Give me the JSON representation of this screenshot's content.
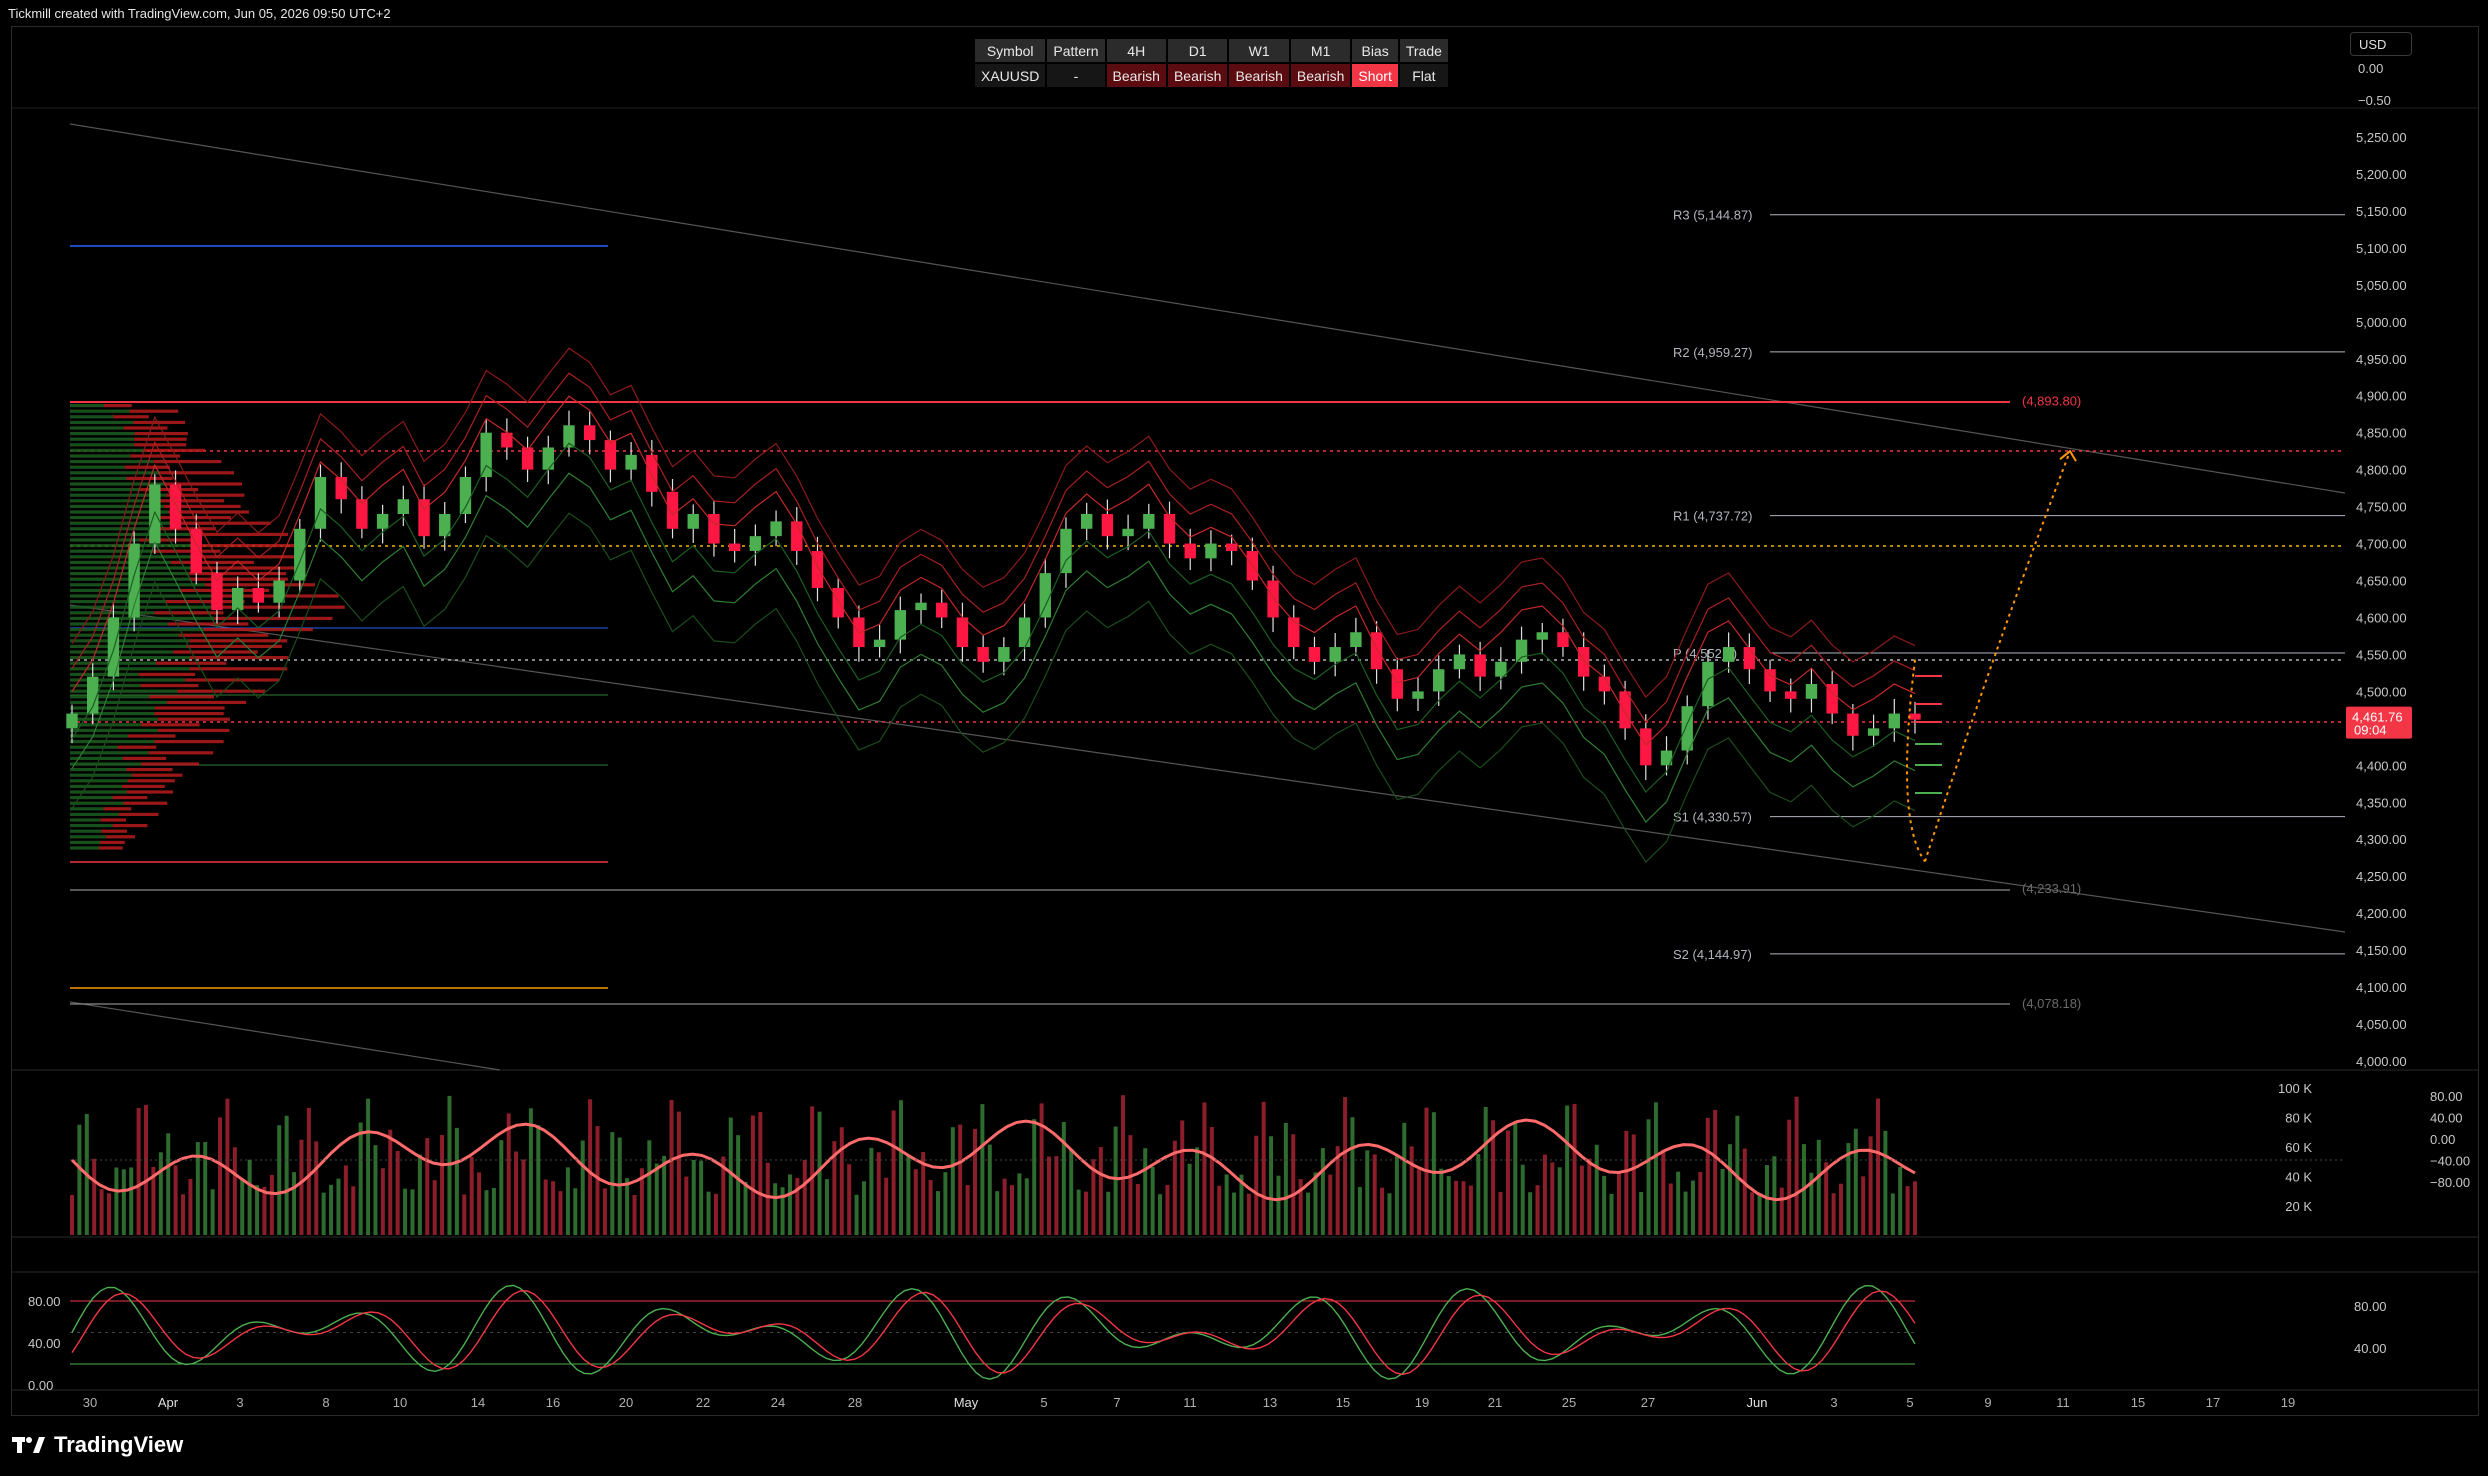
{
  "header": {
    "credit": "Tickmill created with TradingView.com, Jun 05, 2026 09:50 UTC+2"
  },
  "footer": {
    "brand": "TradingView"
  },
  "currency": "USD",
  "bias_table": {
    "headers": [
      "Symbol",
      "Pattern",
      "4H",
      "D1",
      "W1",
      "M1",
      "Bias",
      "Trade"
    ],
    "values": [
      "XAUUSD",
      "-",
      "Bearish",
      "Bearish",
      "Bearish",
      "Bearish",
      "Short",
      "Flat"
    ]
  },
  "colors": {
    "bull": "#2e7d32",
    "bear": "#f23645",
    "pivot": "#b2b5be",
    "dotted": "#f2b600",
    "projection": "#ff9800"
  },
  "chart_data": [
    {
      "type": "candlestick",
      "symbol": "XAUUSD",
      "ylim": [
        4000,
        5250
      ],
      "y_ticks": [
        "5,250.00",
        "5,200.00",
        "5,150.00",
        "5,100.00",
        "5,050.00",
        "5,000.00",
        "4,950.00",
        "4,900.00",
        "4,850.00",
        "4,800.00",
        "4,750.00",
        "4,700.00",
        "4,650.00",
        "4,600.00",
        "4,550.00",
        "4,500.00",
        "4,450.00",
        "4,400.00",
        "4,350.00",
        "4,300.00",
        "4,250.00",
        "4,200.00",
        "4,150.00",
        "4,100.00",
        "4,050.00",
        "4,000.00"
      ],
      "top_axis_ticks": [
        "0.00",
        "−0.50"
      ],
      "x_ticks": [
        "30",
        "Apr",
        "3",
        "8",
        "10",
        "14",
        "16",
        "20",
        "22",
        "24",
        "28",
        "May",
        "5",
        "7",
        "11",
        "13",
        "15",
        "19",
        "21",
        "25",
        "27",
        "Jun",
        "3",
        "5",
        "9",
        "11",
        "15",
        "17",
        "19"
      ],
      "close_series": [
        4470,
        4520,
        4600,
        4700,
        4780,
        4720,
        4660,
        4610,
        4640,
        4620,
        4650,
        4720,
        4790,
        4760,
        4720,
        4740,
        4760,
        4710,
        4740,
        4790,
        4850,
        4830,
        4800,
        4830,
        4860,
        4840,
        4800,
        4820,
        4770,
        4720,
        4740,
        4700,
        4690,
        4710,
        4730,
        4690,
        4640,
        4600,
        4560,
        4570,
        4610,
        4620,
        4600,
        4560,
        4540,
        4560,
        4600,
        4660,
        4720,
        4740,
        4710,
        4720,
        4740,
        4700,
        4680,
        4700,
        4690,
        4650,
        4600,
        4560,
        4540,
        4560,
        4580,
        4530,
        4490,
        4500,
        4530,
        4550,
        4520,
        4540,
        4570,
        4580,
        4560,
        4520,
        4500,
        4450,
        4400,
        4420,
        4480,
        4540,
        4560,
        4530,
        4500,
        4490,
        4510,
        4470,
        4440,
        4450,
        4470,
        4461.76
      ],
      "current_price": {
        "label": "4,461.76",
        "countdown": "09:04"
      },
      "levels": [
        {
          "name": "R3",
          "label": "R3 (5,144.87)",
          "value": 5144.87
        },
        {
          "name": "R2",
          "label": "R2 (4,959.27)",
          "value": 4959.27
        },
        {
          "name": "R1",
          "label": "R1 (4,737.72)",
          "value": 4737.72
        },
        {
          "name": "P",
          "label": "P (4,552...)",
          "value": 4552
        },
        {
          "name": "S1",
          "label": "S1 (4,330.57)",
          "value": 4330.57
        },
        {
          "name": "S2",
          "label": "S2 (4,144.97)",
          "value": 4144.97
        }
      ],
      "price_labels": [
        {
          "label": "(4,893.80)",
          "value": 4893.8
        },
        {
          "label": "(4,233.91)",
          "value": 4233.91
        },
        {
          "label": "(4,078.18)",
          "value": 4078.18
        }
      ],
      "projection": {
        "from": 4461.76,
        "low": 4270,
        "target": 4825
      }
    },
    {
      "type": "bar",
      "name": "volume",
      "y_ticks_left": [
        "100 K",
        "80 K",
        "60 K",
        "40 K",
        "20 K"
      ],
      "y_ticks_right": [
        "80.00",
        "40.00",
        "0.00",
        "−40.00",
        "−80.00"
      ]
    },
    {
      "type": "line",
      "name": "stochastic",
      "ylim": [
        0,
        100
      ],
      "y_ticks": [
        "80.00",
        "40.00",
        "0.00"
      ],
      "y_ticks_right": [
        "80.00",
        "40.00"
      ],
      "levels": [
        80,
        20
      ]
    }
  ]
}
